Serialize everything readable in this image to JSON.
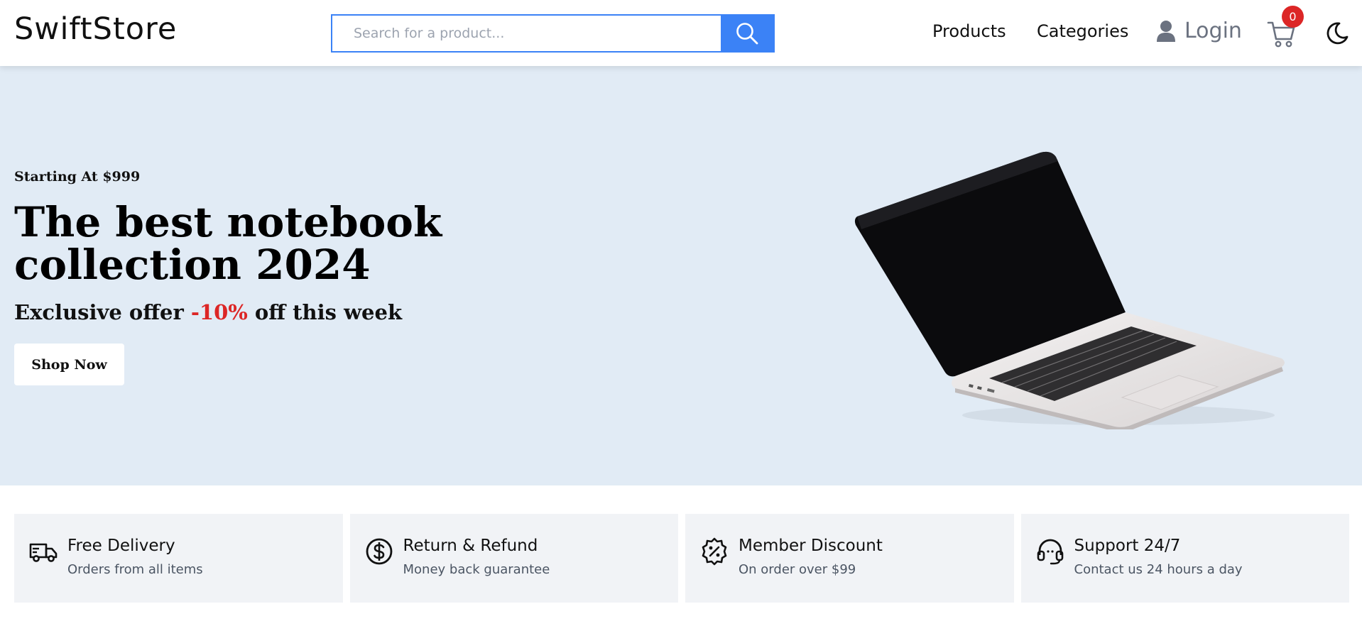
{
  "header": {
    "logo": "SwiftStore",
    "search": {
      "placeholder": "Search for a product...",
      "value": ""
    },
    "nav": {
      "products": "Products",
      "categories": "Categories",
      "login": "Login"
    },
    "cart_count": "0",
    "colors": {
      "accent": "#3b82f6",
      "badge": "#dc2626"
    }
  },
  "hero": {
    "kicker": "Starting At $999",
    "title": "The best notebook collection 2024",
    "offer_prefix": "Exclusive offer ",
    "offer_discount": "-10%",
    "offer_suffix": " off this week",
    "cta": "Shop Now",
    "background": "#e1ebf5"
  },
  "features": [
    {
      "icon": "truck-icon",
      "title": "Free Delivery",
      "subtitle": "Orders from all items"
    },
    {
      "icon": "dollar-circle-icon",
      "title": "Return & Refund",
      "subtitle": "Money back guarantee"
    },
    {
      "icon": "percent-badge-icon",
      "title": "Member Discount",
      "subtitle": "On order over $99"
    },
    {
      "icon": "headset-icon",
      "title": "Support 24/7",
      "subtitle": "Contact us 24 hours a day"
    }
  ]
}
